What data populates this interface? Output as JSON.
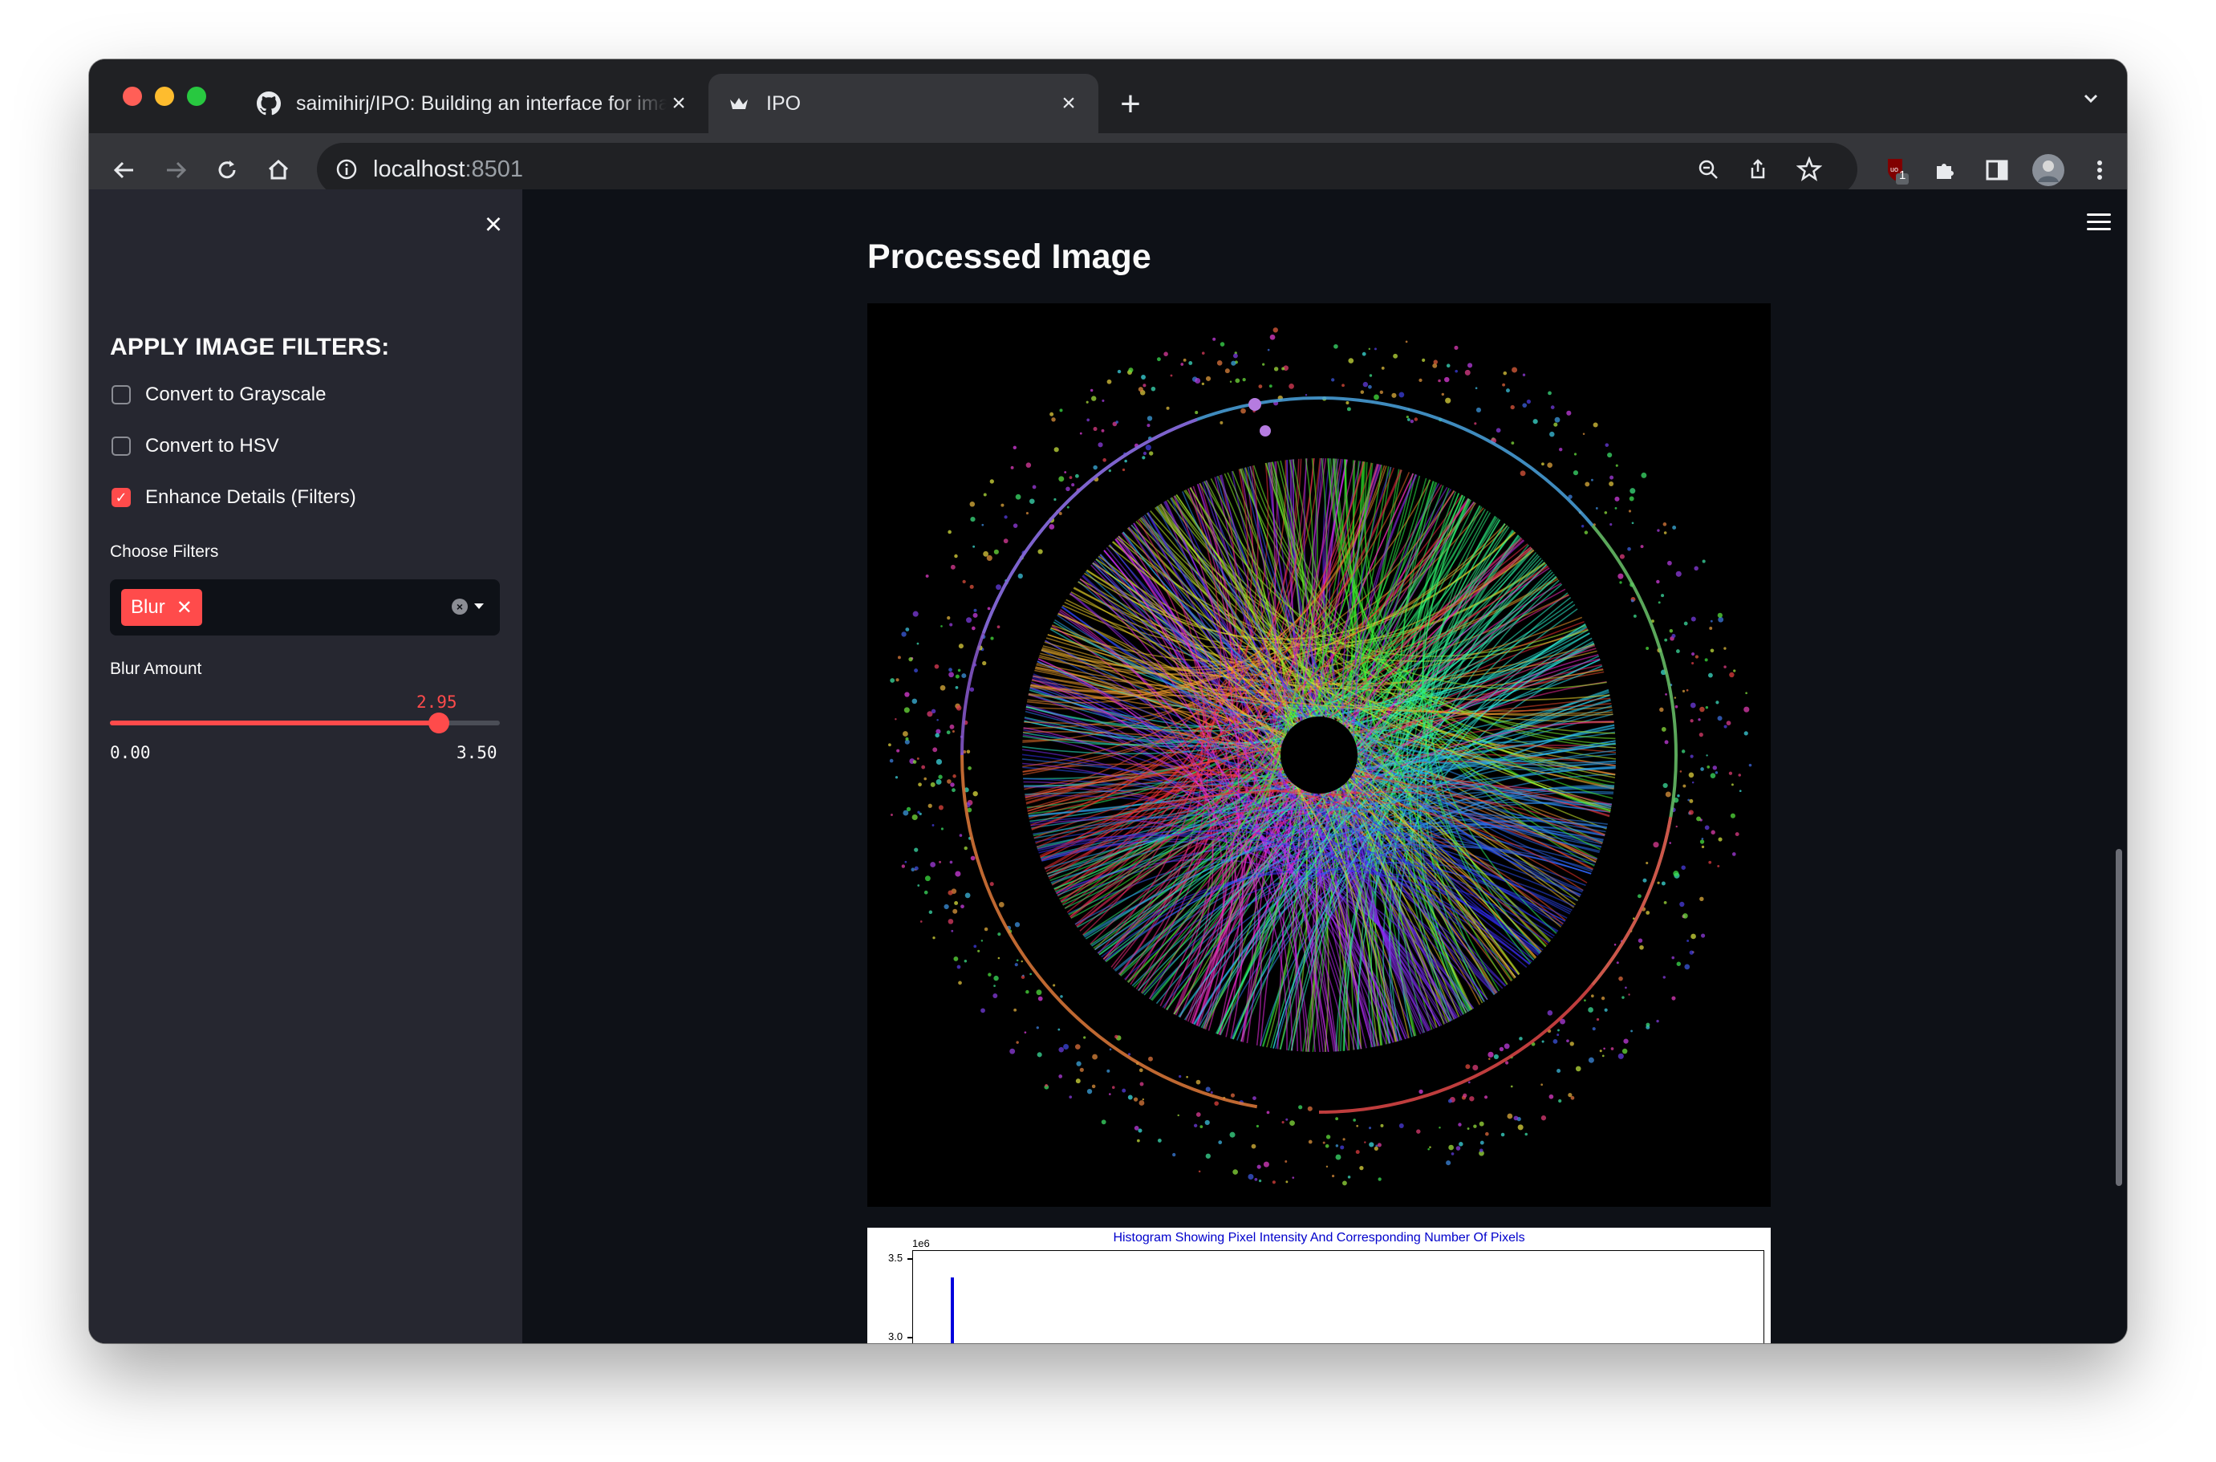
{
  "browser": {
    "tabs": [
      {
        "title": "saimihirj/IPO: Building an interface for image processing"
      },
      {
        "title": "IPO"
      }
    ],
    "url_host": "localhost",
    "url_port": ":8501",
    "extension_badge": "1"
  },
  "sidebar": {
    "heading": "APPLY IMAGE FILTERS:",
    "checkboxes": [
      {
        "label": "Convert to Grayscale",
        "checked": false
      },
      {
        "label": "Convert to HSV",
        "checked": false
      },
      {
        "label": "Enhance Details (Filters)",
        "checked": true
      }
    ],
    "filters_label": "Choose Filters",
    "selected_filters": [
      "Blur"
    ],
    "blur_label": "Blur Amount",
    "blur_value": "2.95",
    "blur_fraction": 0.843,
    "blur_min": "0.00",
    "blur_max": "3.50"
  },
  "main": {
    "title": "Processed Image",
    "histogram": {
      "title": "Histogram Showing Pixel Intensity And Corresponding Number Of Pixels",
      "exponent": "1e6",
      "yticks": [
        "3.5",
        "3.0"
      ]
    }
  },
  "colors": {
    "accent": "#ff4b4b",
    "sidebar_bg": "#262730",
    "main_bg": "#0e1117"
  }
}
